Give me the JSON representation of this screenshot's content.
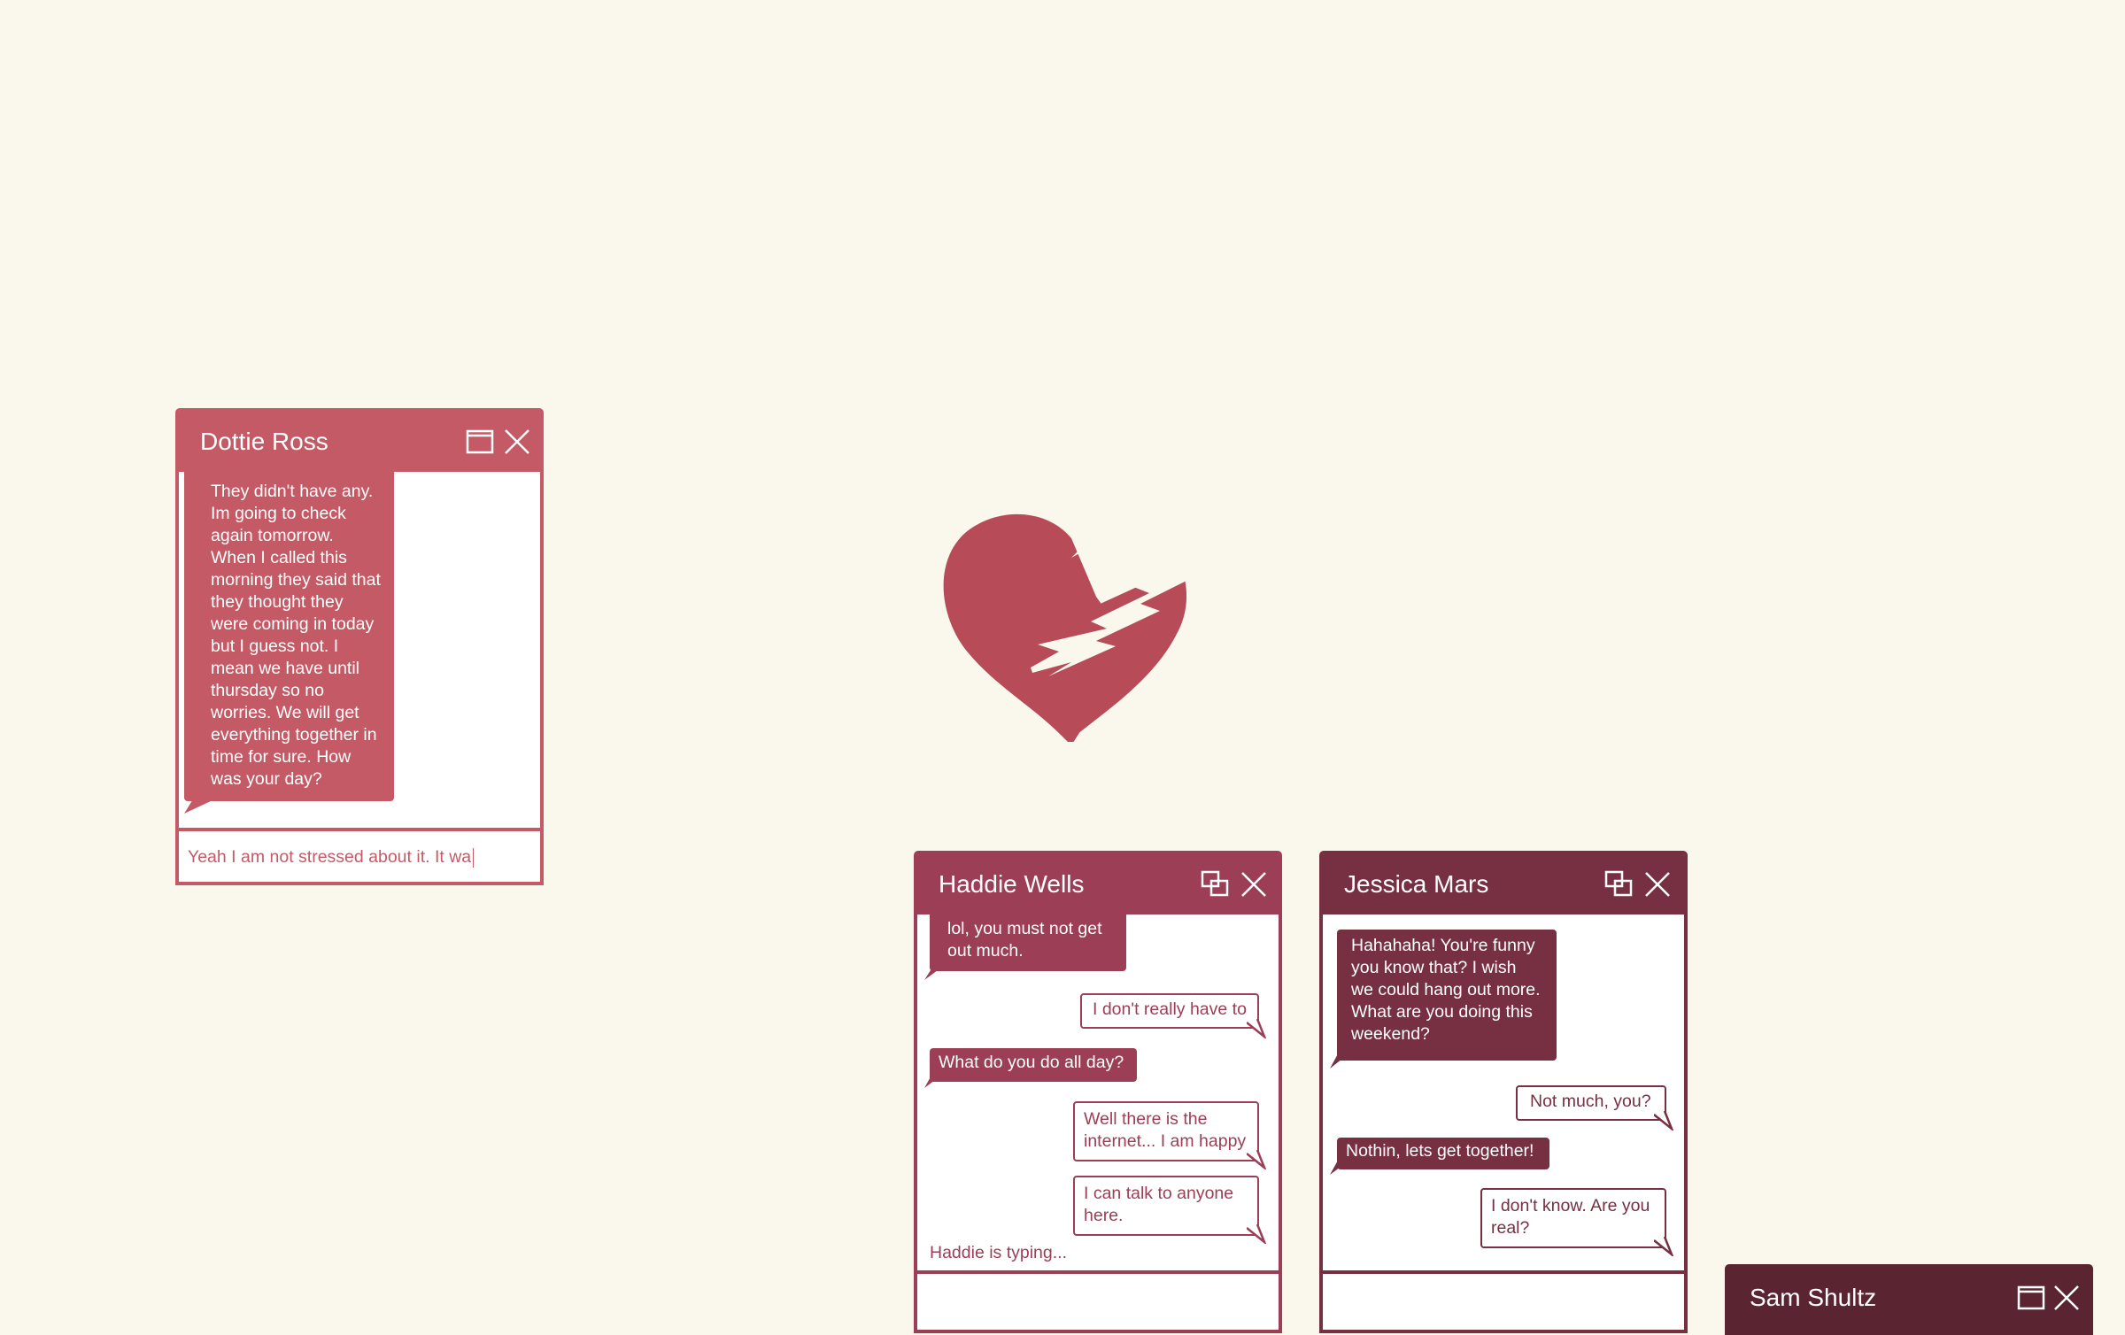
{
  "colors": {
    "background": "#faf7ec",
    "dottie": "#c45a66",
    "haddie": "#9c3e55",
    "jessica": "#772f42",
    "sam": "#5b2431",
    "heart": "#b74b57"
  },
  "icons": {
    "maximize": "maximize-icon",
    "restore": "restore-icon",
    "close": "close-icon",
    "heart": "broken-heart-icon"
  },
  "dottie": {
    "name": "Dottie Ross",
    "message": "They didn't have any. Im going to check again tomorrow. When I called this morning they said that they thought they were coming in today but I guess not. I mean we have until thursday so no worries. We will get everything together in time for sure. How was your day?",
    "input_value": "Yeah I am not stressed about it. It wa"
  },
  "haddie": {
    "name": "Haddie Wells",
    "messages": [
      "lol, you must not get out much.",
      "I don't really have to",
      "What do you do all day?",
      "Well there is the internet... I am happy",
      "I can talk to anyone here."
    ],
    "typing": "Haddie is typing..."
  },
  "jessica": {
    "name": "Jessica Mars",
    "messages": [
      "Hahahaha! You're funny you know that? I wish we could hang out more. What are you doing this weekend?",
      "Not much, you?",
      "Nothin, lets get together!",
      "I don't know. Are you real?"
    ]
  },
  "sam": {
    "name": "Sam Shultz"
  }
}
